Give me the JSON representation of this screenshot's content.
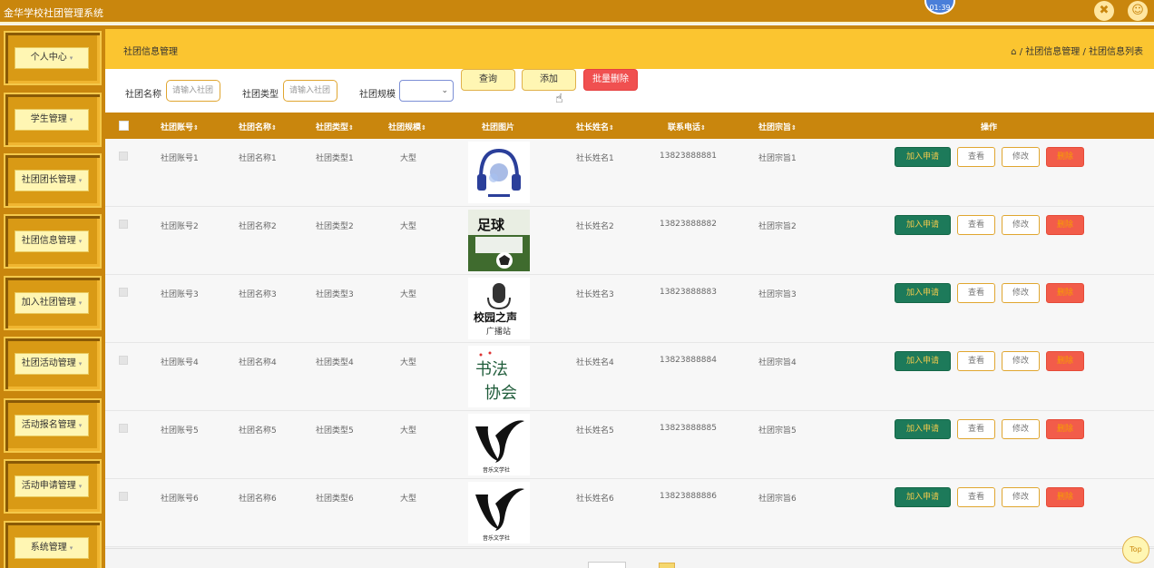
{
  "app": {
    "title": "金华学校社团管理系统",
    "clock": "01:39"
  },
  "sidebar": {
    "items": [
      {
        "label": "个人中心"
      },
      {
        "label": "学生管理"
      },
      {
        "label": "社团团长管理"
      },
      {
        "label": "社团信息管理"
      },
      {
        "label": "加入社团管理"
      },
      {
        "label": "社团活动管理"
      },
      {
        "label": "活动报名管理"
      },
      {
        "label": "活动申请管理"
      },
      {
        "label": "系统管理"
      }
    ]
  },
  "header": {
    "section": "社团信息管理",
    "breadcrumb": "/ 社团信息管理 / 社团信息列表"
  },
  "search": {
    "name_label": "社团名称",
    "name_placeholder": "请输入社团",
    "type_label": "社团类型",
    "type_placeholder": "请输入社团",
    "scale_label": "社团规模",
    "query_label": "查询",
    "add_label": "添加",
    "batch_delete_label": "批量删除"
  },
  "table": {
    "headers": [
      "社团账号",
      "社团名称",
      "社团类型",
      "社团规模",
      "社团图片",
      "社长姓名",
      "联系电话",
      "社团宗旨",
      "操作"
    ],
    "rows": [
      {
        "account": "社团账号1",
        "name": "社团名称1",
        "type": "社团类型1",
        "scale": "大型",
        "leader": "社长姓名1",
        "phone": "13823888881",
        "purpose": "社团宗旨1"
      },
      {
        "account": "社团账号2",
        "name": "社团名称2",
        "type": "社团类型2",
        "scale": "大型",
        "leader": "社长姓名2",
        "phone": "13823888882",
        "purpose": "社团宗旨2"
      },
      {
        "account": "社团账号3",
        "name": "社团名称3",
        "type": "社团类型3",
        "scale": "大型",
        "leader": "社长姓名3",
        "phone": "13823888883",
        "purpose": "社团宗旨3"
      },
      {
        "account": "社团账号4",
        "name": "社团名称4",
        "type": "社团类型4",
        "scale": "大型",
        "leader": "社长姓名4",
        "phone": "13823888884",
        "purpose": "社团宗旨4"
      },
      {
        "account": "社团账号5",
        "name": "社团名称5",
        "type": "社团类型5",
        "scale": "大型",
        "leader": "社长姓名5",
        "phone": "13823888885",
        "purpose": "社团宗旨5"
      },
      {
        "account": "社团账号6",
        "name": "社团名称6",
        "type": "社团类型6",
        "scale": "大型",
        "leader": "社长姓名6",
        "phone": "13823888886",
        "purpose": "社团宗旨6"
      }
    ],
    "actions": {
      "join": "加入申请",
      "view": "查看",
      "edit": "修改",
      "delete": "删除"
    },
    "pictures": {
      "row2": "足球",
      "row3": "校园之声",
      "row3b": "广播站",
      "row4": "书法",
      "row4b": "协会",
      "row5": "音乐文学社",
      "row6": "音乐文学社"
    }
  },
  "footer": {
    "top_label": "Top"
  },
  "colors": {
    "primary": "#c9860d",
    "header_band": "#fbc530",
    "accent_green": "#1d7a5a",
    "danger": "#f05050"
  },
  "icons": {
    "fullscreen": "fullscreen-icon",
    "user": "user-icon",
    "home": "home-icon",
    "sort": "sort-icon"
  }
}
